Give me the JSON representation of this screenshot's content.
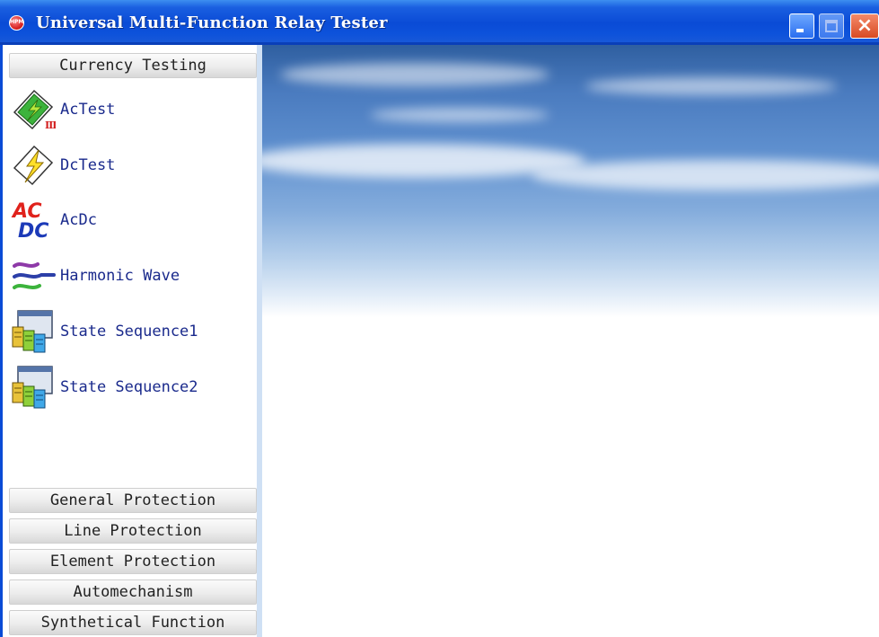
{
  "window": {
    "title": "Universal Multi-Function Relay Tester",
    "icon_text": "HPM",
    "close_glyph": "×"
  },
  "sidebar": {
    "current_category": "Currency Testing",
    "tools": [
      {
        "label": "AcTest",
        "icon": "ac-test-icon"
      },
      {
        "label": "DcTest",
        "icon": "dc-test-icon"
      },
      {
        "label": "AcDc",
        "icon": "acdc-icon"
      },
      {
        "label": "Harmonic Wave",
        "icon": "harmonic-wave-icon"
      },
      {
        "label": "State Sequence1",
        "icon": "state-sequence-icon"
      },
      {
        "label": "State Sequence2",
        "icon": "state-sequence-icon"
      }
    ],
    "acdc_icon_text": {
      "top": "AC",
      "bottom": "DC"
    },
    "categories": [
      "General Protection",
      "Line Protection",
      "Element Protection",
      "Automechanism",
      "Synthetical Function"
    ]
  },
  "colors": {
    "titlebar": "#0a4bd6",
    "tool_label": "#1a2a8c",
    "close_button": "#d84a23"
  }
}
